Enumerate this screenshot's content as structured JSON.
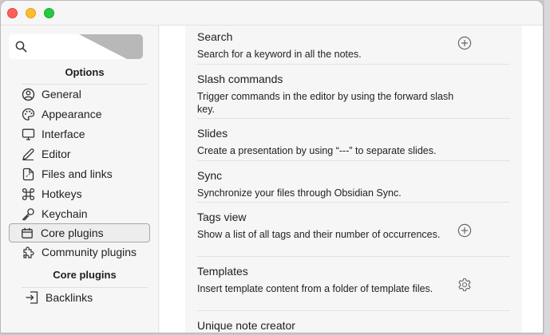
{
  "search": {
    "placeholder": "",
    "value": ""
  },
  "options_heading": "Options",
  "nav": [
    {
      "label": "General",
      "icon": "general-icon"
    },
    {
      "label": "Appearance",
      "icon": "appearance-icon"
    },
    {
      "label": "Interface",
      "icon": "interface-icon"
    },
    {
      "label": "Editor",
      "icon": "editor-icon"
    },
    {
      "label": "Files and links",
      "icon": "files-and-links-icon"
    },
    {
      "label": "Hotkeys",
      "icon": "hotkeys-icon"
    },
    {
      "label": "Keychain",
      "icon": "keychain-icon"
    },
    {
      "label": "Core plugins",
      "icon": "core-plugins-icon",
      "active": true
    },
    {
      "label": "Community plugins",
      "icon": "community-plugins-icon"
    }
  ],
  "core_plugins_heading": "Core plugins",
  "core_plugin_links": [
    {
      "label": "Backlinks",
      "icon": "backlinks-icon"
    }
  ],
  "plugins": [
    {
      "name": "Search",
      "desc": "Search for a keyword in all the notes.",
      "action": "add-icon"
    },
    {
      "name": "Slash commands",
      "desc": "Trigger commands in the editor by using the forward slash key.",
      "action": ""
    },
    {
      "name": "Slides",
      "desc": "Create a presentation by using “---” to separate slides.",
      "action": ""
    },
    {
      "name": "Sync",
      "desc": "Synchronize your files through Obsidian Sync.",
      "action": ""
    },
    {
      "name": "Tags view",
      "desc": "Show a list of all tags and their number of occurrences.",
      "action": "add-icon"
    },
    {
      "name": "Templates",
      "desc": "Insert template content from a folder of template files.",
      "action": "gear-icon"
    },
    {
      "name": "Unique note creator",
      "desc": "",
      "action": ""
    }
  ]
}
